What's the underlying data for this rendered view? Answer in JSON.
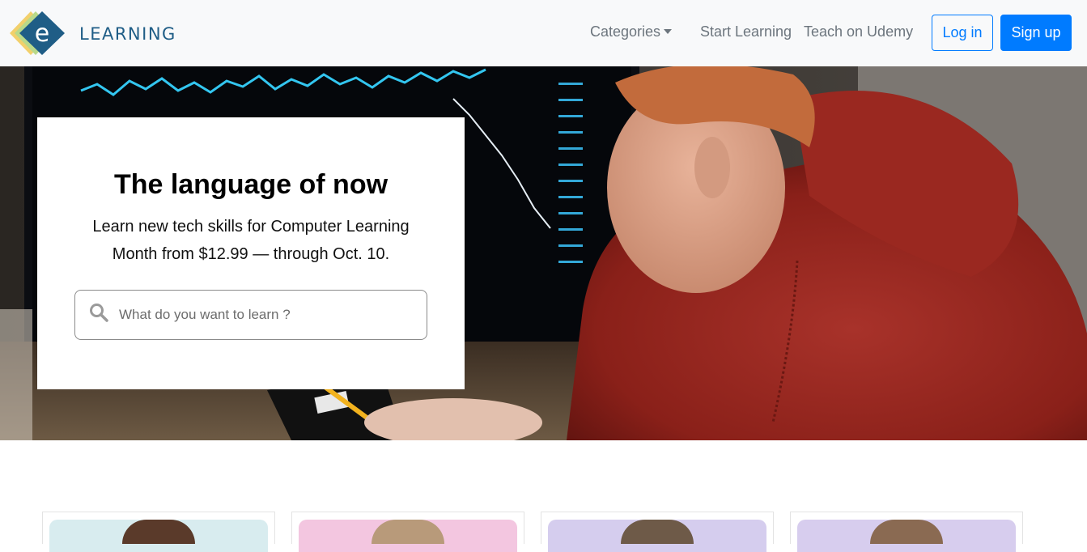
{
  "brand": {
    "logo_letter": "e",
    "name": "LEARNING"
  },
  "nav": {
    "categories_label": "Categories",
    "start_learning_label": "Start Learning",
    "teach_label": "Teach on Udemy",
    "login_label": "Log in",
    "signup_label": "Sign up"
  },
  "hero": {
    "title": "The language of now",
    "subtitle": "Learn new tech skills for Computer Learning Month from $12.99 — through Oct. 10.",
    "search_placeholder": "What do you want to learn ?"
  },
  "colors": {
    "primary": "#007bff",
    "navbar_bg": "#f8f9fa",
    "brand_blue": "#1f5d86",
    "hoodie_red": "#9e2a22"
  },
  "cards": [
    {
      "tint": "#d8ecef"
    },
    {
      "tint": "#f3c6e0"
    },
    {
      "tint": "#d5cdee"
    },
    {
      "tint": "#d7cdee"
    }
  ]
}
